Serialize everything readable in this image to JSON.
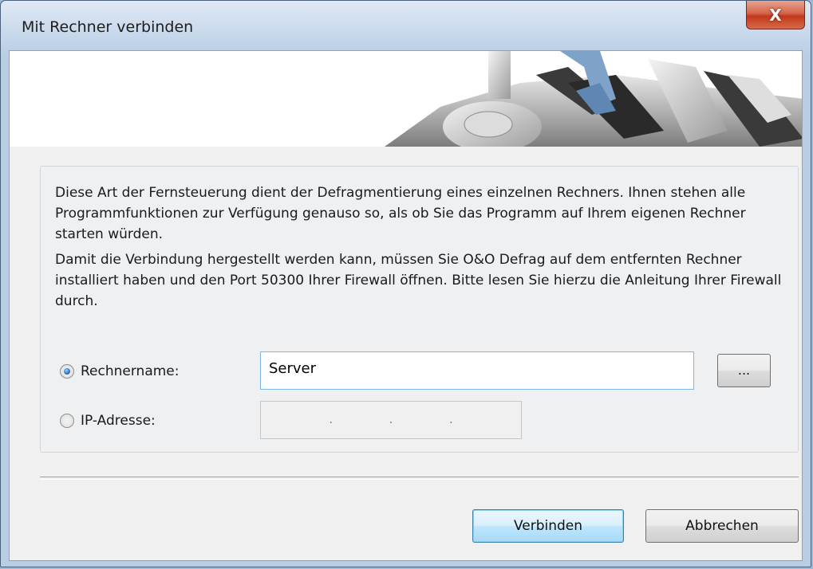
{
  "window": {
    "title": "Mit Rechner verbinden",
    "close_label": "X"
  },
  "description": {
    "paragraph1": "Diese Art der Fernsteuerung dient der Defragmentierung eines einzelnen Rechners. Ihnen stehen alle Programmfunktionen zur Verfügung genauso so, als ob Sie das Programm auf Ihrem eigenen Rechner starten würden.",
    "paragraph2": "Damit die Verbindung hergestellt werden kann, müssen Sie O&O Defrag auf dem entfernten Rechner installiert haben und den Port 50300 Ihrer Firewall öffnen. Bitte lesen Sie hierzu die Anleitung Ihrer Firewall durch."
  },
  "options": {
    "computer_name_label": "Rechnername:",
    "computer_name_value": "Server",
    "computer_name_selected": true,
    "ip_label": "IP-Adresse:",
    "ip_selected": false,
    "ip_dots": [
      ".",
      ".",
      "."
    ],
    "browse_label": "..."
  },
  "buttons": {
    "connect": "Verbinden",
    "cancel": "Abbrechen"
  },
  "colors": {
    "accent": "#3c7fb1",
    "close": "#c0391c"
  }
}
